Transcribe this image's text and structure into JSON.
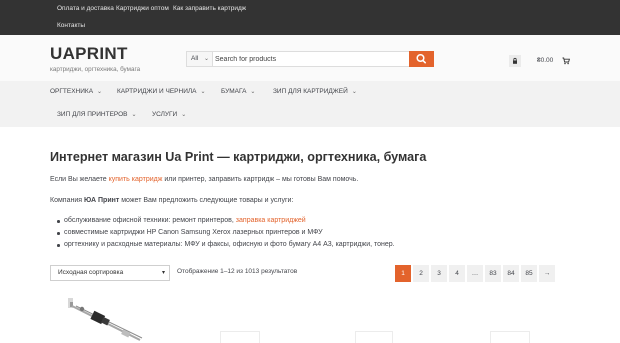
{
  "topbar": {
    "links": [
      "Оплата и доставка",
      "Картриджи оптом",
      "Как заправить картридж",
      "Контакты"
    ]
  },
  "header": {
    "logo": "UAPRINT",
    "tagline": "картриджи, оргтехника, бумага",
    "search_category": "All",
    "search_placeholder": "Search for products",
    "cart_total": "₴0.00"
  },
  "nav": {
    "items": [
      "ОРГТЕХНИКА",
      "КАРТРИДЖИ И ЧЕРНИЛА",
      "БУМАГА",
      "ЗИП ДЛЯ КАРТРИДЖЕЙ",
      "ЗИП ДЛЯ ПРИНТЕРОВ",
      "УСЛУГИ"
    ]
  },
  "content": {
    "title": "Интернет магазин Ua Print — картриджи, оргтехника, бумага",
    "intro_before": "Если Вы желаете ",
    "intro_link": "купить картридж",
    "intro_after": " или принтер, заправить картридж – мы готовы Вам помочь.",
    "offer_before": "Компания ",
    "offer_company": "ЮА Принт",
    "offer_after": " может Вам предложить следующие товары и услуги:",
    "bullets": [
      {
        "text": "обслуживание офисной техники: ремонт принтеров, ",
        "link": "заправка картриджей"
      },
      {
        "text": "совместимые картриджи HP Canon Samsung Xerox лазерных принтеров и МФУ",
        "link": ""
      },
      {
        "text": "оргтехнику и расходные материалы: МФУ и факсы, офисную и фото бумагу А4 А3, картриджи, тонер.",
        "link": ""
      }
    ]
  },
  "shop": {
    "sort_selected": "Исходная сортировка",
    "result_count": "Отображение 1–12 из 1013 результатов",
    "pages": [
      "1",
      "2",
      "3",
      "4",
      "…",
      "83",
      "84",
      "85",
      "→"
    ],
    "current_page": "1"
  },
  "colors": {
    "accent": "#e3632c",
    "topbar": "#333333",
    "nav_bg": "#f2f2f2"
  }
}
